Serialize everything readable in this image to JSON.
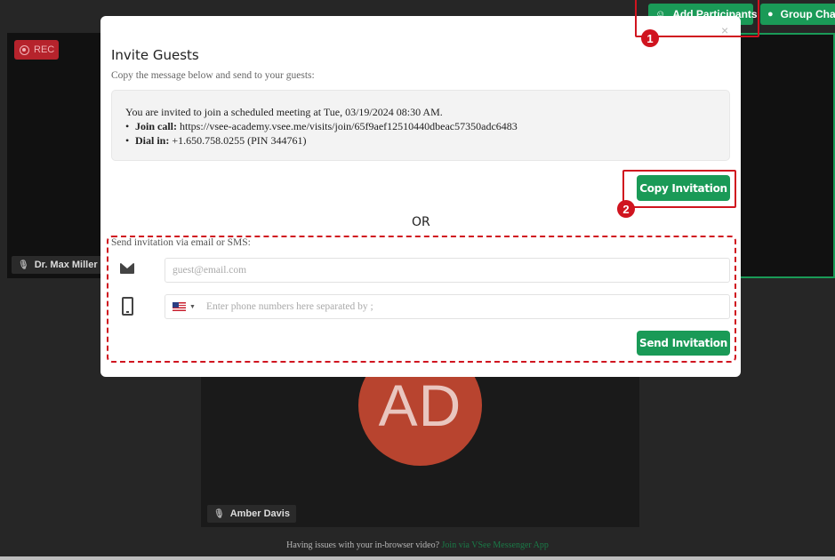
{
  "call": {
    "rec_label": "REC",
    "participant_max": "Dr. Max Miller (r",
    "participant_amber": "Amber Davis",
    "avatar_initials": "AD",
    "add_participants_label": "Add Participants",
    "group_chat_label": "Group Chat",
    "footer_text": "Having issues with your in-browser video?",
    "footer_link": "Join via VSee Messenger App"
  },
  "annotations": {
    "badge1": "1",
    "badge2": "2"
  },
  "modal": {
    "title": "Invite Guests",
    "subtitle": "Copy the message below and send to your guests:",
    "close_glyph": "×",
    "message_line": "You are invited to join a scheduled meeting at Tue, 03/19/2024 08:30 AM.",
    "join_label": "Join call:",
    "join_url": "https://vsee-academy.vsee.me/visits/join/65f9aef12510440dbeac57350adc6483",
    "dial_label": "Dial in:",
    "dial_value": "+1.650.758.0255 (PIN 344761)",
    "copy_button": "Copy Invitation",
    "or_label": "OR",
    "send_label": "Send invitation via email or SMS:",
    "email_placeholder": "guest@email.com",
    "phone_placeholder": "Enter phone numbers here separated by ;",
    "send_button": "Send Invitation"
  },
  "colors": {
    "accent": "#1a9a57",
    "annotation": "#d0141f",
    "rec": "#b6232c",
    "avatar": "#b8442f"
  }
}
